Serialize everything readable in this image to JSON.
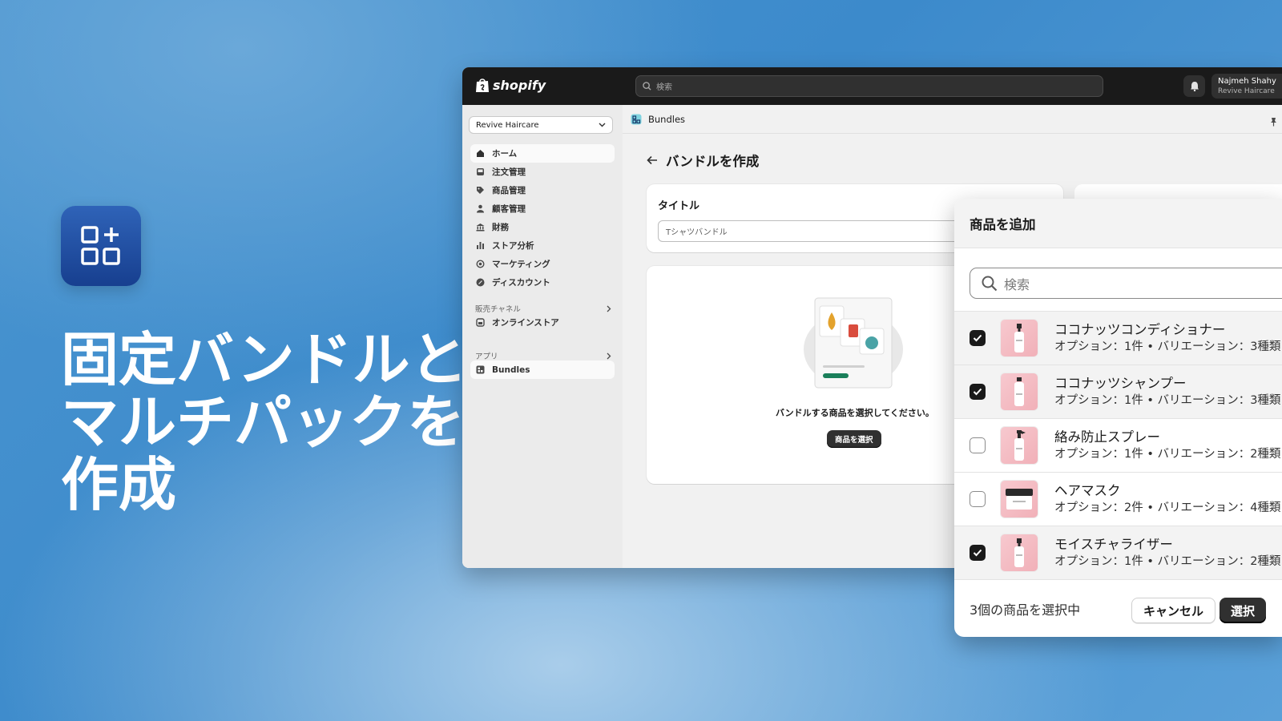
{
  "hero": {
    "line1": "固定バンドルと",
    "line2": "マルチパックを",
    "line3": "作成"
  },
  "topbar": {
    "logo": "shopify",
    "search_placeholder": "検索",
    "user_name": "Najmeh Shahy",
    "user_store": "Revive Haircare"
  },
  "sidebar": {
    "store": "Revive Haircare",
    "items": [
      {
        "label": "ホーム",
        "icon": "home-icon"
      },
      {
        "label": "注文管理",
        "icon": "inbox-icon"
      },
      {
        "label": "商品管理",
        "icon": "tag-icon"
      },
      {
        "label": "顧客管理",
        "icon": "person-icon"
      },
      {
        "label": "財務",
        "icon": "bank-icon"
      },
      {
        "label": "ストア分析",
        "icon": "bar-chart-icon"
      },
      {
        "label": "マーケティング",
        "icon": "target-icon"
      },
      {
        "label": "ディスカウント",
        "icon": "discount-icon"
      }
    ],
    "sales_channels_label": "販売チャネル",
    "online_store": "オンラインストア",
    "apps_label": "アプリ",
    "bundles": "Bundles"
  },
  "breadcrumb": "Bundles",
  "page": {
    "title": "バンドルを作成",
    "title_card_label": "タイトル",
    "title_placeholder": "Tシャツバンドル",
    "empty_text": "バンドルする商品を選択してください。",
    "select_products": "商品を選択"
  },
  "modal": {
    "title": "商品を追加",
    "search_placeholder": "検索",
    "products": [
      {
        "name": "ココナッツコンディショナー",
        "sub": "オプション：1件 • バリエーション：3種類",
        "checked": true
      },
      {
        "name": "ココナッツシャンプー",
        "sub": "オプション：1件 • バリエーション：3種類",
        "checked": true
      },
      {
        "name": "絡み防止スプレー",
        "sub": "オプション：1件 • バリエーション：2種類",
        "checked": false
      },
      {
        "name": "ヘアマスク",
        "sub": "オプション：2件 • バリエーション：4種類",
        "checked": false
      },
      {
        "name": "モイスチャライザー",
        "sub": "オプション：1件 • バリエーション：2種類",
        "checked": true
      }
    ],
    "selected_count": "3個の商品を選択中",
    "cancel": "キャンセル",
    "select": "選択"
  },
  "colors": {
    "accent_dark": "#303030",
    "badge_green": "#1a7f5a"
  }
}
